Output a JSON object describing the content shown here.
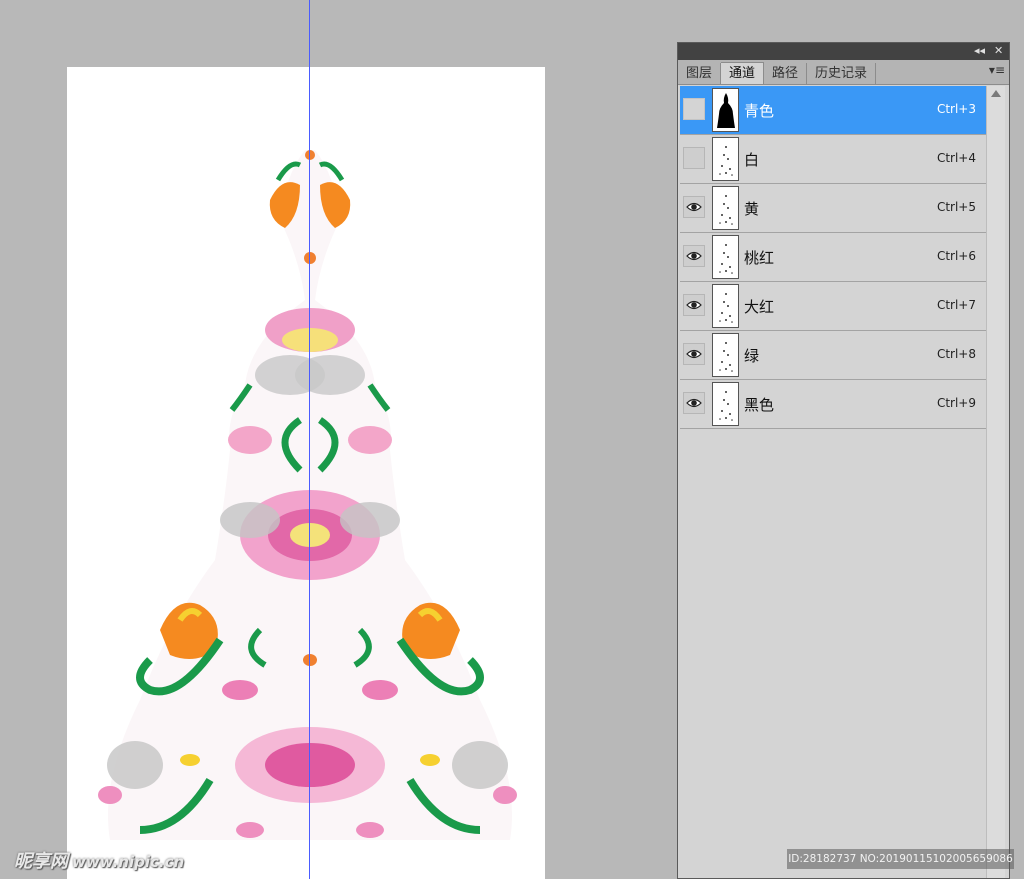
{
  "panel": {
    "titlebar_collapse": "◂◂",
    "titlebar_close": "✕",
    "menu_icon": "▾≡",
    "tabs": [
      {
        "label": "图层",
        "active": false
      },
      {
        "label": "通道",
        "active": true
      },
      {
        "label": "路径",
        "active": false
      },
      {
        "label": "历史记录",
        "active": false
      }
    ],
    "channels": [
      {
        "name": "青色",
        "shortcut": "Ctrl+3",
        "visible": false,
        "selected": true
      },
      {
        "name": "白",
        "shortcut": "Ctrl+4",
        "visible": false,
        "selected": false
      },
      {
        "name": "黄",
        "shortcut": "Ctrl+5",
        "visible": true,
        "selected": false
      },
      {
        "name": "桃红",
        "shortcut": "Ctrl+6",
        "visible": true,
        "selected": false
      },
      {
        "name": "大红",
        "shortcut": "Ctrl+7",
        "visible": true,
        "selected": false
      },
      {
        "name": "绿",
        "shortcut": "Ctrl+8",
        "visible": true,
        "selected": false
      },
      {
        "name": "黑色",
        "shortcut": "Ctrl+9",
        "visible": true,
        "selected": false
      }
    ]
  },
  "watermark": {
    "left_logo": "昵享网",
    "left_url": "www.nipic.cn",
    "right_id": "ID:28182737 NO:20190115102005659086"
  },
  "colors": {
    "selection": "#3a98f6",
    "guide": "#4a5cff",
    "workspace": "#b8b8b8",
    "panel_bg": "#d4d4d4"
  }
}
